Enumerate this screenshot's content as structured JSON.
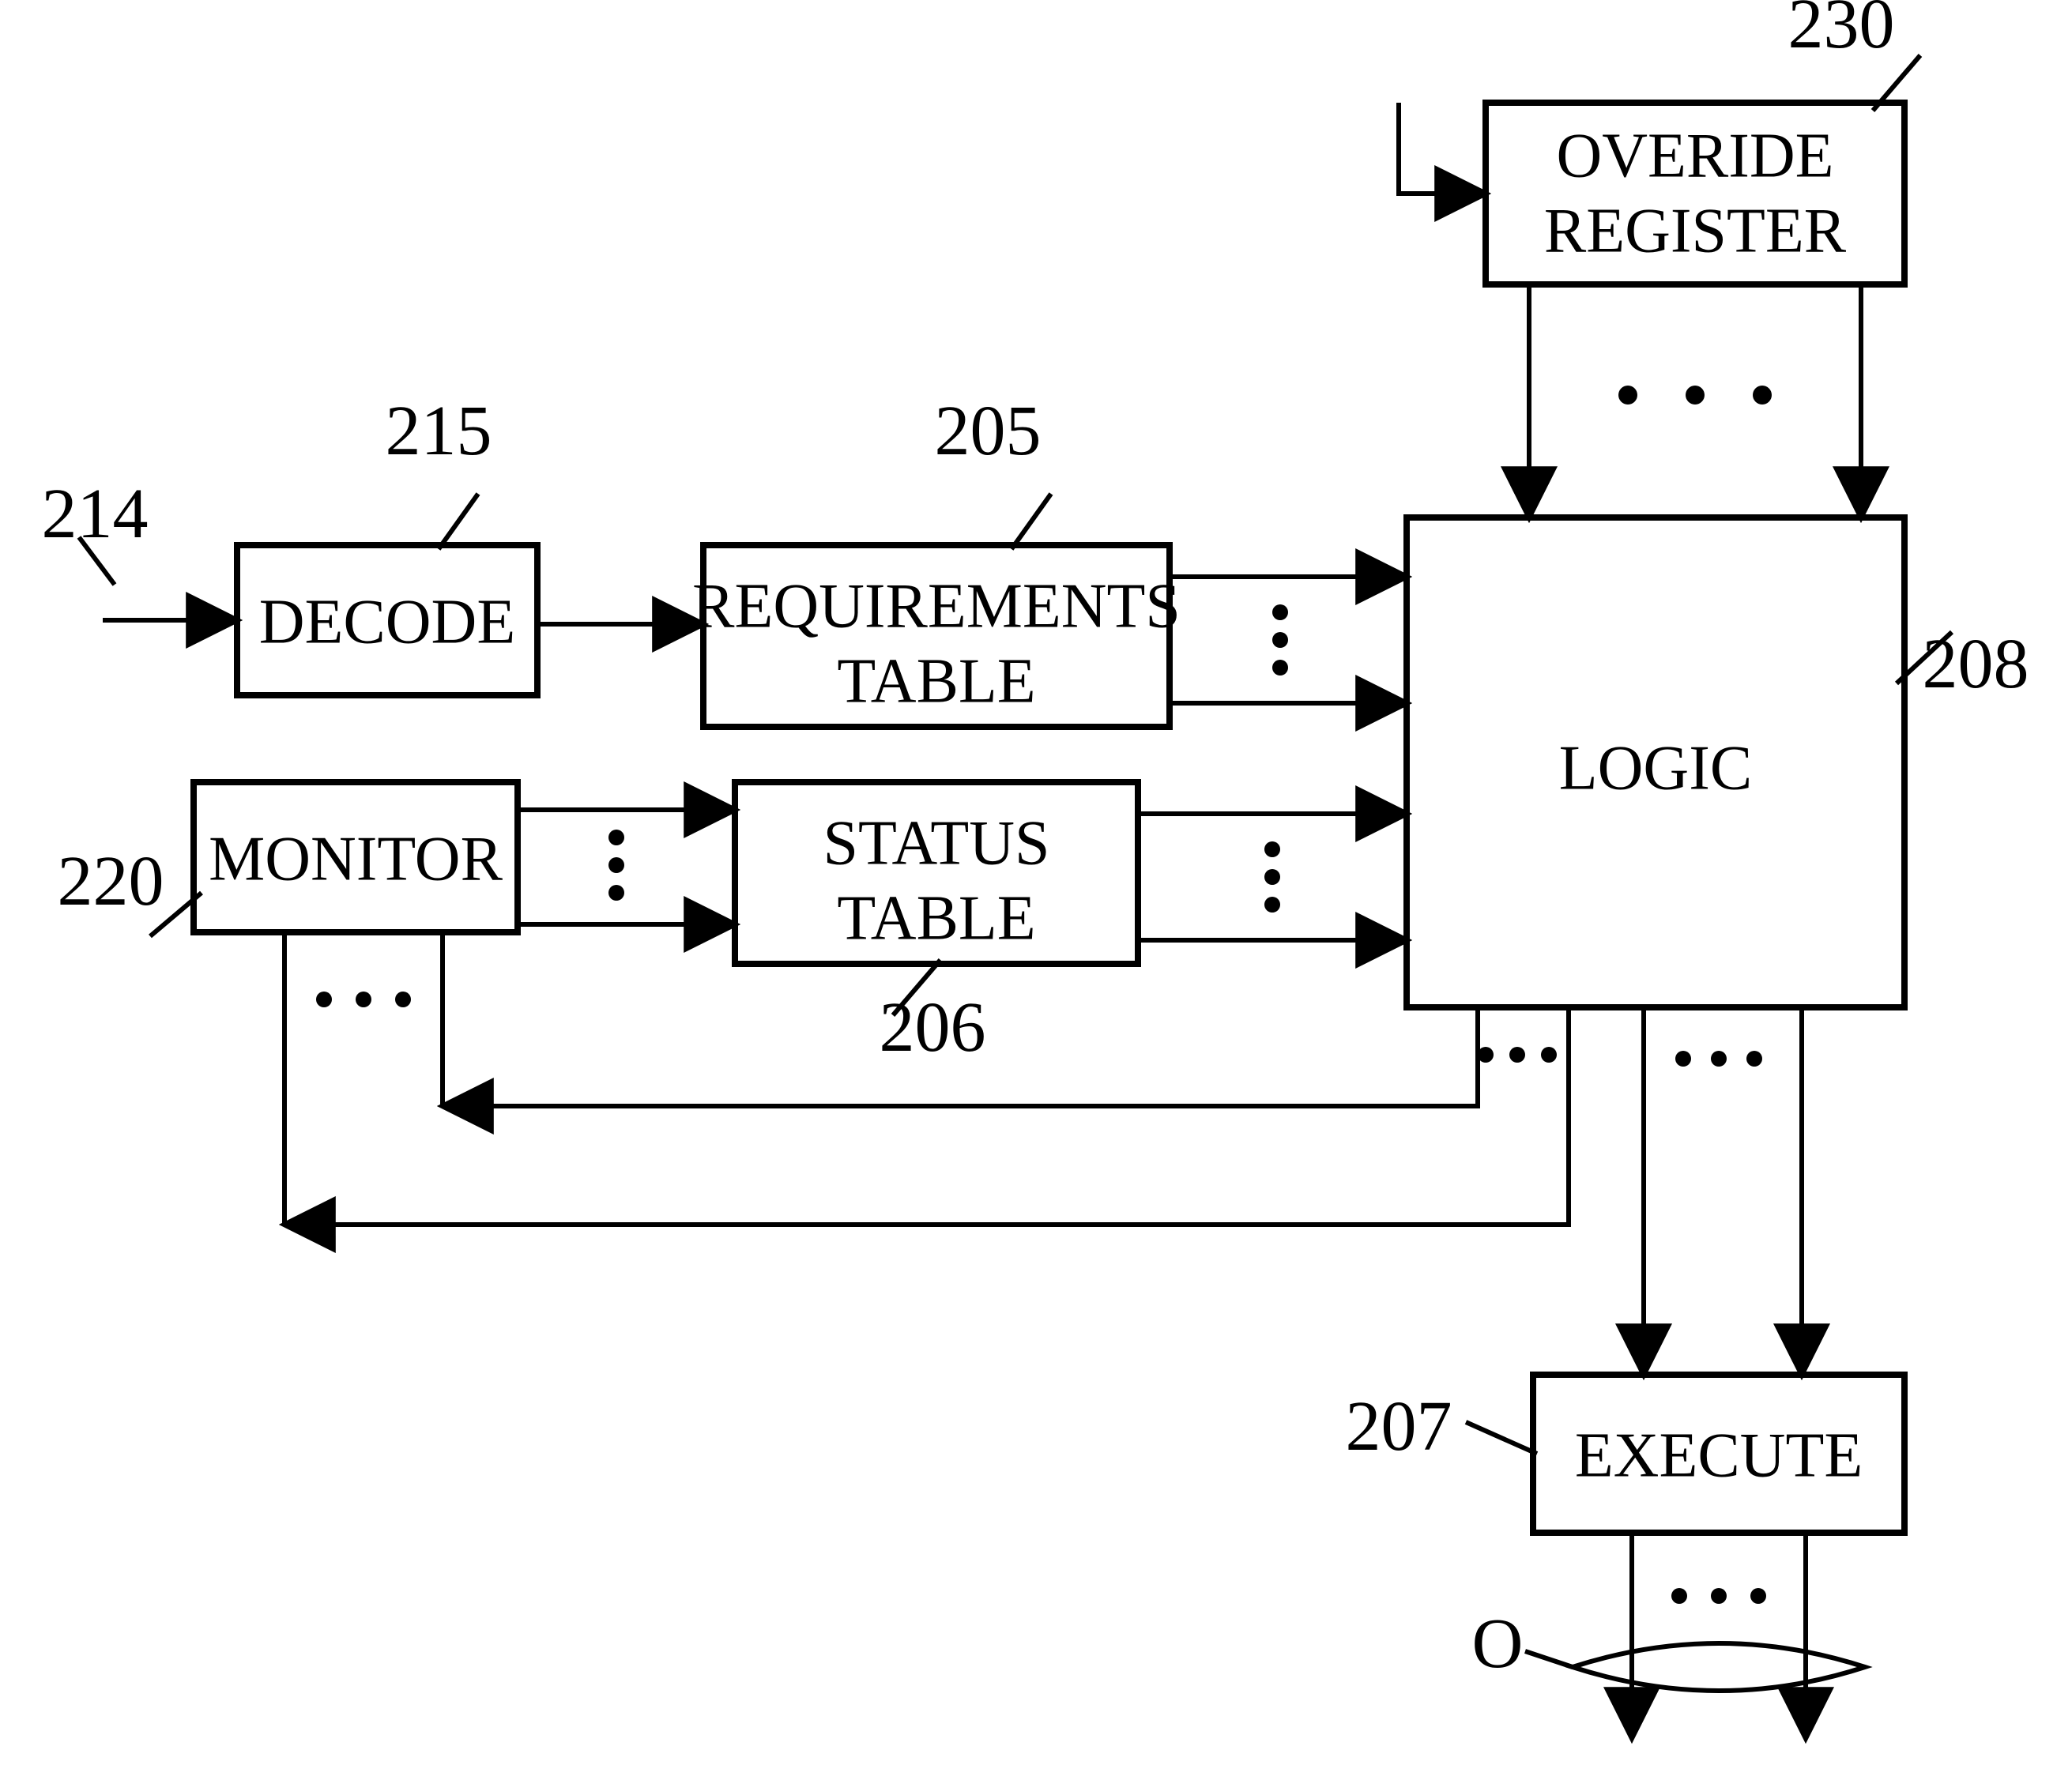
{
  "blocks": {
    "decode": {
      "label": "DECODE",
      "ref": "215"
    },
    "requirements": {
      "label1": "REQUIREMENTS",
      "label2": "TABLE",
      "ref": "205"
    },
    "status": {
      "label1": "STATUS",
      "label2": "TABLE",
      "ref": "206"
    },
    "monitor": {
      "label": "MONITOR",
      "ref": "220"
    },
    "override": {
      "label1": "OVERIDE",
      "label2": "REGISTER",
      "ref": "230"
    },
    "logic": {
      "label": "LOGIC",
      "ref": "208"
    },
    "execute": {
      "label": "EXECUTE",
      "ref": "207"
    }
  },
  "inputRef": "214",
  "outputLabel": "O"
}
